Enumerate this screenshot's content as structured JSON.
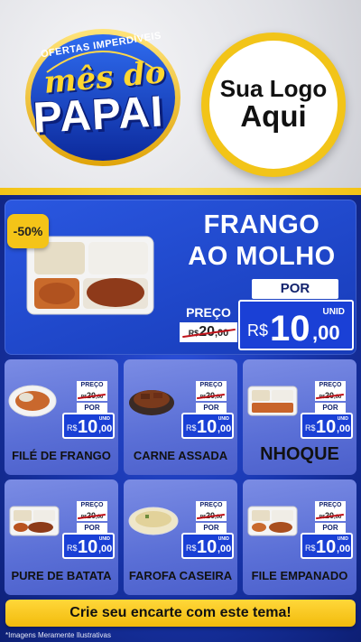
{
  "header": {
    "seal_top": "OFERTAS IMPERDÍVEIS",
    "seal_line1": "mês do",
    "seal_line2": "PAPAI",
    "logo_line1": "Sua Logo",
    "logo_line2": "Aqui"
  },
  "featured": {
    "badge": "-50%",
    "title_line1": "FRANGO",
    "title_line2": "AO MOLHO",
    "preco_label": "PREÇO",
    "old_currency": "R$",
    "old_int": "20",
    "old_dec": ",00",
    "por_label": "POR",
    "unid_label": "UNID",
    "new_currency": "R$",
    "new_int": "10",
    "new_dec": ",00"
  },
  "cards": [
    {
      "name": "FILÉ DE FRANGO",
      "preco_label": "PREÇO",
      "old_currency": "R$",
      "old_int": "20",
      "old_dec": ",00",
      "por_label": "POR",
      "unid_label": "UNID",
      "new_currency": "R$",
      "new_int": "10",
      "new_dec": ",00"
    },
    {
      "name": "CARNE ASSADA",
      "preco_label": "PREÇO",
      "old_currency": "R$",
      "old_int": "20",
      "old_dec": ",00",
      "por_label": "POR",
      "unid_label": "UNID",
      "new_currency": "R$",
      "new_int": "10",
      "new_dec": ",00"
    },
    {
      "name": "NHOQUE",
      "preco_label": "PREÇO",
      "old_currency": "R$",
      "old_int": "20",
      "old_dec": ",00",
      "por_label": "POR",
      "unid_label": "UNID",
      "new_currency": "R$",
      "new_int": "10",
      "new_dec": ",00"
    },
    {
      "name": "PURE DE BATATA",
      "preco_label": "PREÇO",
      "old_currency": "R$",
      "old_int": "20",
      "old_dec": ",00",
      "por_label": "POR",
      "unid_label": "UNID",
      "new_currency": "R$",
      "new_int": "10",
      "new_dec": ",00"
    },
    {
      "name": "FAROFA CASEIRA",
      "preco_label": "PREÇO",
      "old_currency": "R$",
      "old_int": "20",
      "old_dec": ",00",
      "por_label": "POR",
      "unid_label": "UNID",
      "new_currency": "R$",
      "new_int": "10",
      "new_dec": ",00"
    },
    {
      "name": "FILE EMPANADO",
      "preco_label": "PREÇO",
      "old_currency": "R$",
      "old_int": "20",
      "old_dec": ",00",
      "por_label": "POR",
      "unid_label": "UNID",
      "new_currency": "R$",
      "new_int": "10",
      "new_dec": ",00"
    }
  ],
  "cta": "Crie seu encarte com este tema!",
  "disclaimer": "*Imagens Meramente Ilustrativas",
  "colors": {
    "brand_blue": "#1a40d6",
    "gold": "#f4c418",
    "strike_red": "#c0141b"
  },
  "icons": [
    "food-tray-icon",
    "food-plate-icon",
    "food-bowl-icon"
  ]
}
